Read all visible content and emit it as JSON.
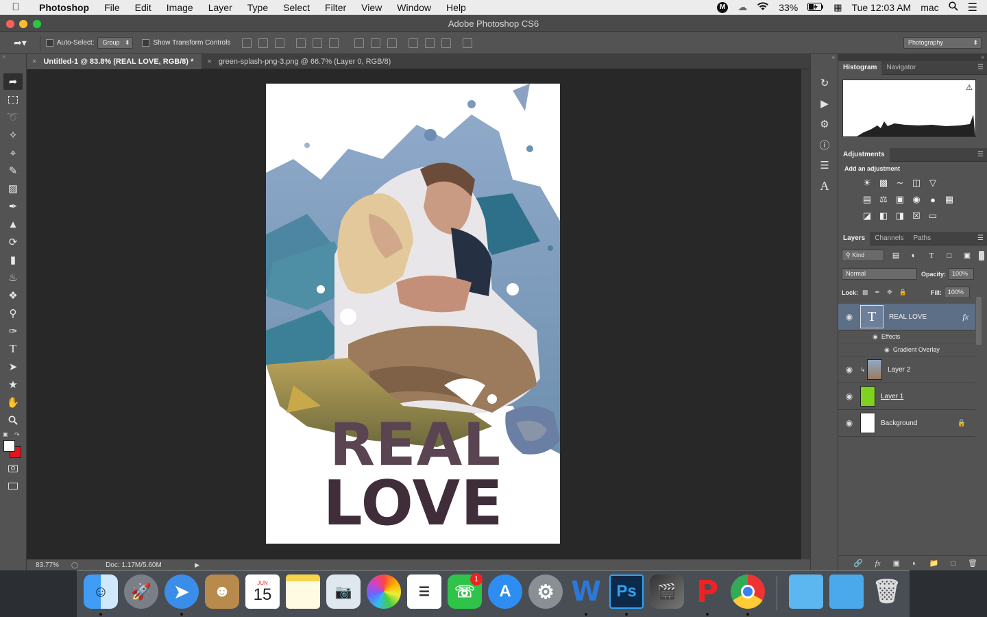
{
  "menubar": {
    "app": "Photoshop",
    "items": [
      "File",
      "Edit",
      "Image",
      "Layer",
      "Type",
      "Select",
      "Filter",
      "View",
      "Window",
      "Help"
    ],
    "battery": "33%",
    "clock": "Tue 12:03 AM",
    "user": "mac"
  },
  "window": {
    "title": "Adobe Photoshop CS6"
  },
  "options": {
    "auto_select_label": "Auto-Select:",
    "auto_select_value": "Group",
    "transform_label": "Show Transform Controls",
    "workspace": "Photography"
  },
  "tabs": [
    {
      "label": "Untitled-1 @ 83.8% (REAL LOVE, RGB/8) *"
    },
    {
      "label": "green-splash-png-3.png @ 66.7% (Layer 0, RGB/8)"
    }
  ],
  "status": {
    "zoom": "83.77%",
    "doc": "Doc: 1.17M/5.60M"
  },
  "artwork": {
    "line1": "REAL",
    "line2": "LOVE",
    "text_color": "#5a4452"
  },
  "panels": {
    "histogram_tab": "Histogram",
    "navigator_tab": "Navigator",
    "adjustments_tab": "Adjustments",
    "add_adjustment": "Add an adjustment",
    "layers_tab": "Layers",
    "channels_tab": "Channels",
    "paths_tab": "Paths",
    "kind": "Kind",
    "blend_mode": "Normal",
    "opacity_label": "Opacity:",
    "opacity": "100%",
    "lock_label": "Lock:",
    "fill_label": "Fill:",
    "fill": "100%"
  },
  "layers": {
    "real_love": "REAL LOVE",
    "effects": "Effects",
    "gradient": "Gradient Overlay",
    "layer2": "Layer 2",
    "layer1": "Layer 1",
    "background": "Background"
  },
  "dock": {
    "calendar_month": "JUN",
    "calendar_day": "15",
    "facetime_badge": "1",
    "ps_label": "Ps"
  }
}
